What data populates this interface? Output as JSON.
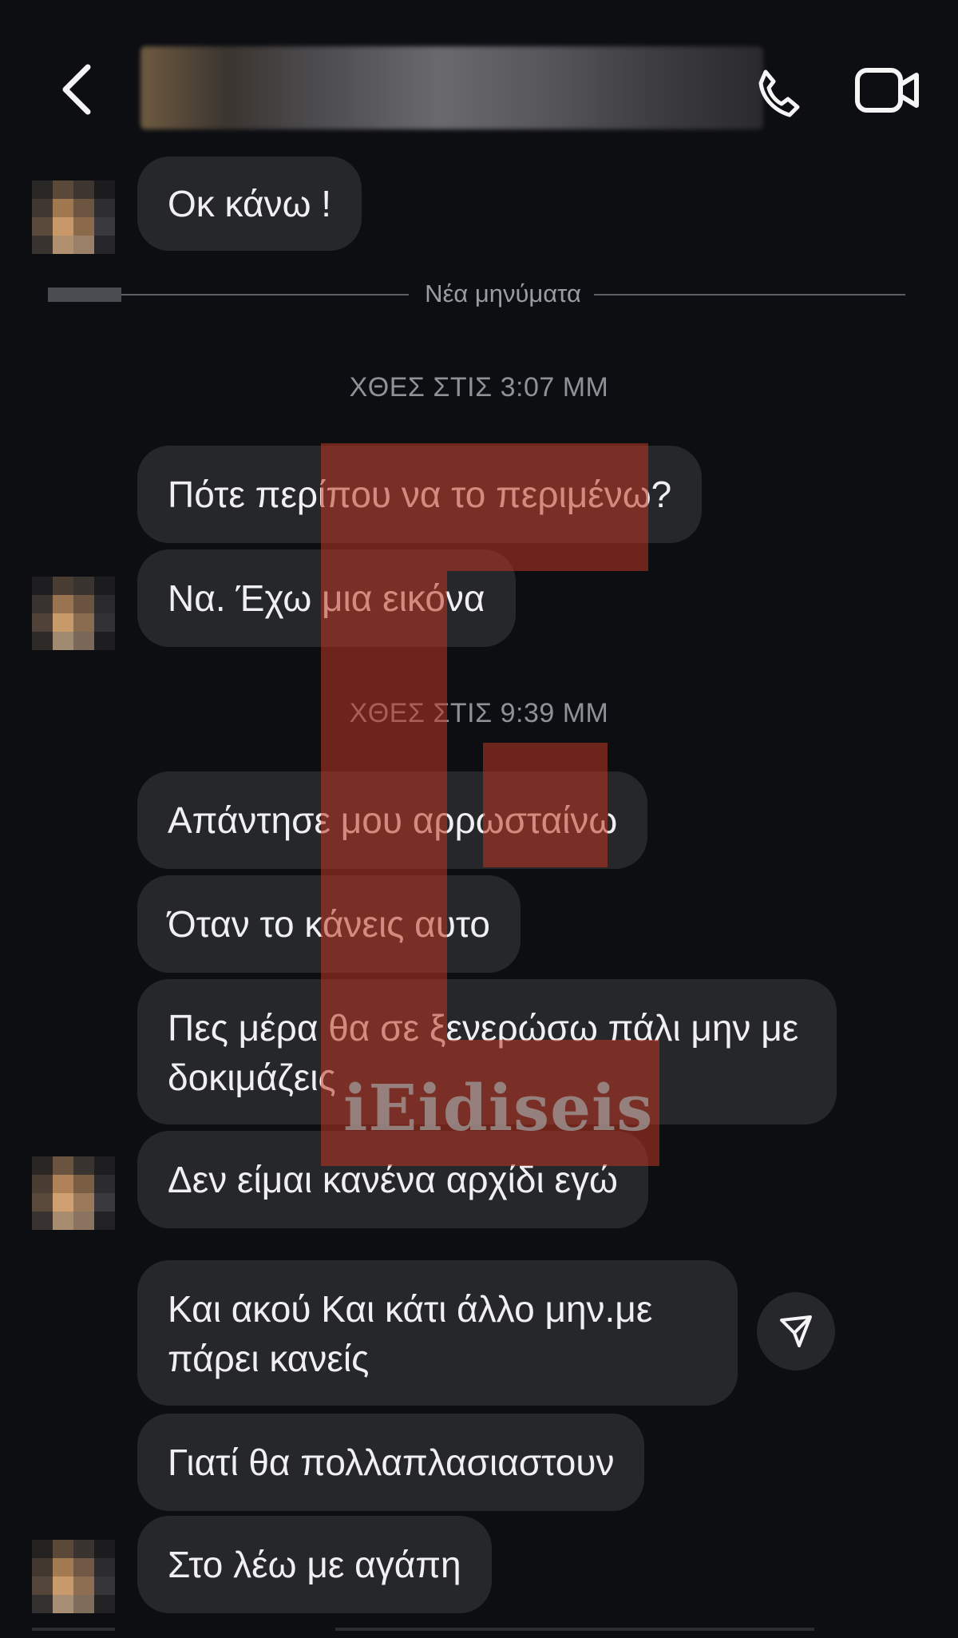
{
  "header": {
    "back_icon": "chevron-left-icon",
    "call_icon": "phone-icon",
    "video_icon": "video-camera-icon"
  },
  "divider": {
    "label": "Νέα μηνύματα"
  },
  "messages": {
    "m1": "Οκ κάνω !",
    "t1": "ΧΘΕΣ ΣΤΙΣ 3:07 ΜΜ",
    "m2": "Πότε περίπου να το περιμένω?",
    "m3": "Να. Έχω μια εικόνα",
    "t2": "ΧΘΕΣ ΣΤΙΣ 9:39 ΜΜ",
    "m4": "Απάντησε μου αρρωσταίνω",
    "m5": "Όταν το κάνεις αυτο",
    "m6": "Πες μέρα θα σε ξενερώσω πάλι μην με δοκιμάζεις",
    "m7": "Δεν είμαι κανένα αρχίδι εγώ",
    "m8": "Και ακού Και κάτι άλλο μην.με πάρει κανείς",
    "m9": "Γιατί θα πολλαπλασιαστουν",
    "m10": "Στο λέω με αγάπη"
  },
  "watermark": {
    "text": "iEidiseis"
  },
  "colors": {
    "background": "#0c0e12",
    "bubble": "#26272b",
    "watermark": "#be3620"
  }
}
